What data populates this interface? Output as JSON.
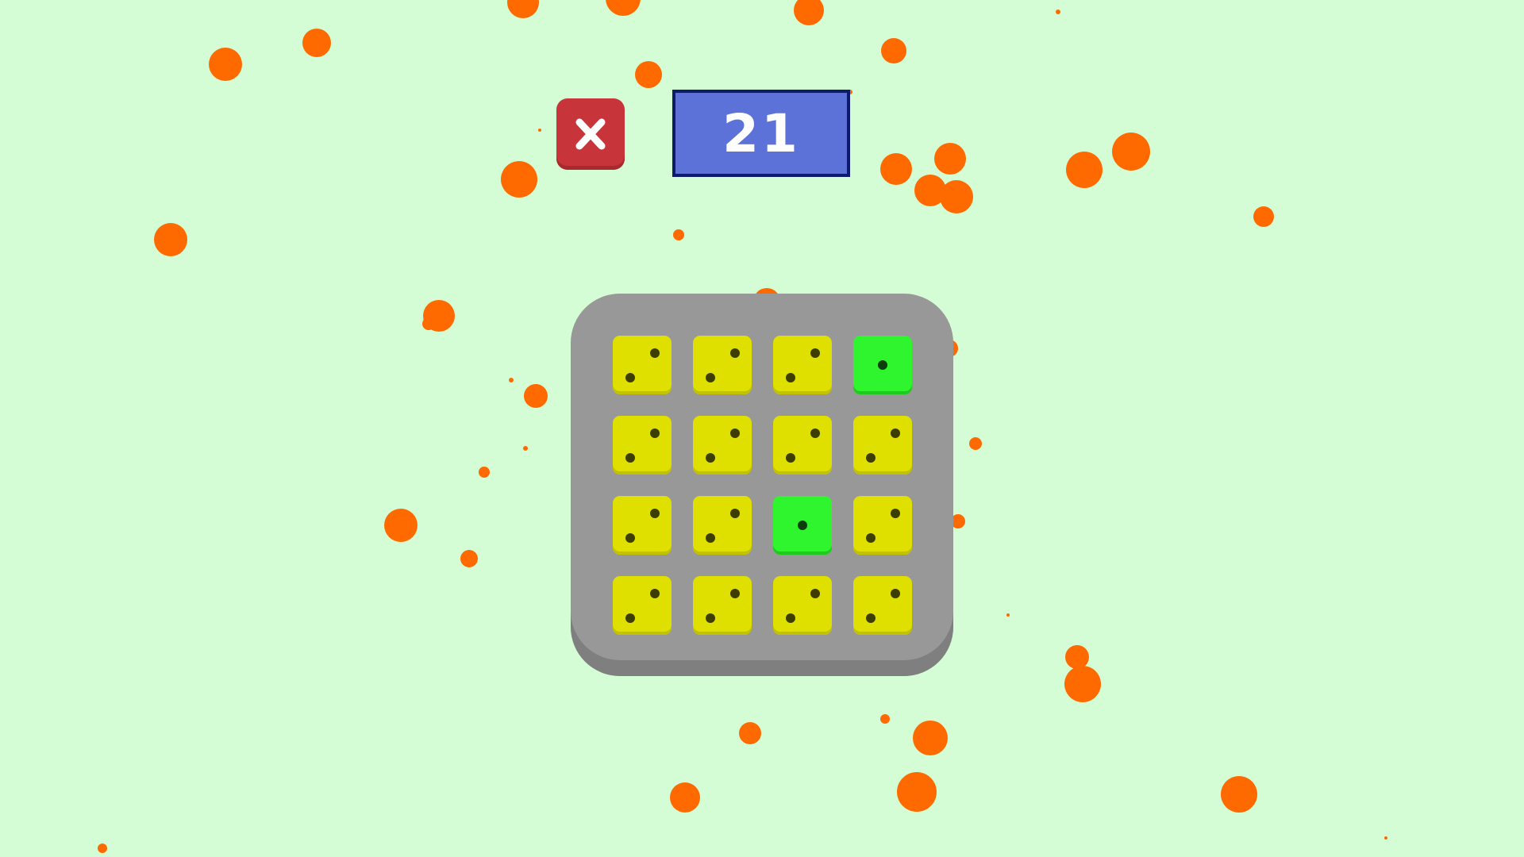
{
  "game": {
    "score": "21",
    "close_icon": "close-icon",
    "colors": {
      "background": "#d5fdd5",
      "particle": "#ff6a00",
      "board": "#989898",
      "tile_yellow": "#dfdf00",
      "tile_green": "#2ef52e",
      "close_button": "#c7353b",
      "score_box": "#5d72d9",
      "score_border": "#0e1a6a"
    },
    "board": {
      "rows": 4,
      "cols": 4,
      "tiles": [
        {
          "color": "yellow",
          "pips": 2
        },
        {
          "color": "yellow",
          "pips": 2
        },
        {
          "color": "yellow",
          "pips": 2
        },
        {
          "color": "green",
          "pips": 1
        },
        {
          "color": "yellow",
          "pips": 2
        },
        {
          "color": "yellow",
          "pips": 2
        },
        {
          "color": "yellow",
          "pips": 2
        },
        {
          "color": "yellow",
          "pips": 2
        },
        {
          "color": "yellow",
          "pips": 2
        },
        {
          "color": "yellow",
          "pips": 2
        },
        {
          "color": "green",
          "pips": 1
        },
        {
          "color": "yellow",
          "pips": 2
        },
        {
          "color": "yellow",
          "pips": 2
        },
        {
          "color": "yellow",
          "pips": 2
        },
        {
          "color": "yellow",
          "pips": 2
        },
        {
          "color": "yellow",
          "pips": 2
        }
      ]
    }
  }
}
